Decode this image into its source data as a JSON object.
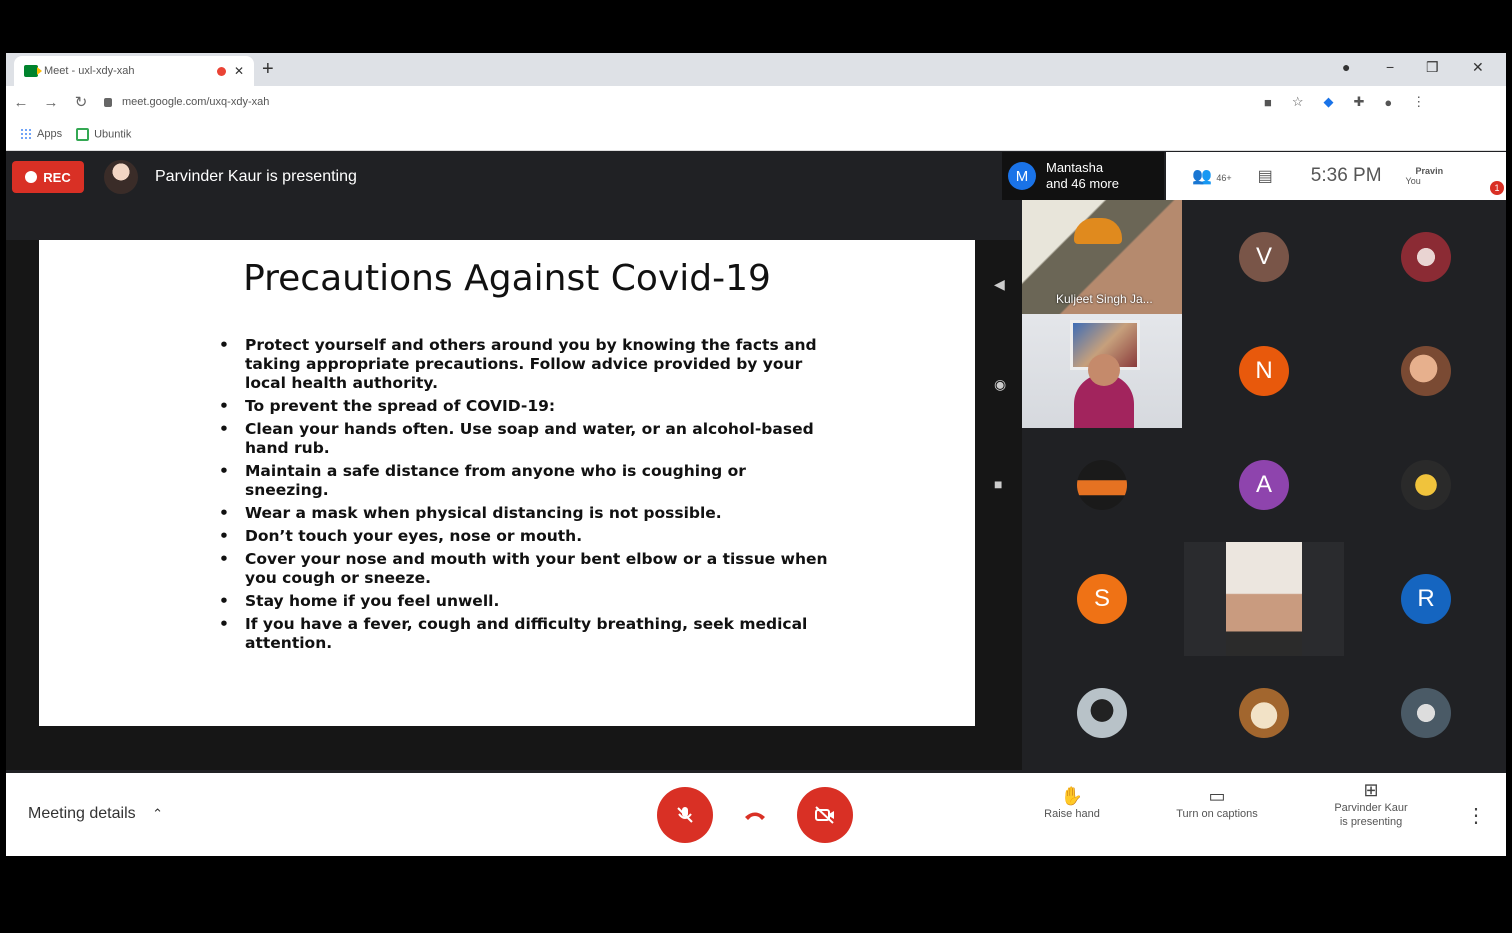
{
  "browser": {
    "tab_title": "Meet - uxl-xdy-xah",
    "new_tab_icon": "+",
    "window_controls": [
      "−",
      "❒",
      "✕"
    ],
    "url": "meet.google.com/uxq-xdy-xah",
    "bookmarks": [
      "Apps",
      "Ubuntik"
    ]
  },
  "header": {
    "rec_label": "REC",
    "presenting_text": "Parvinder Kaur is presenting",
    "participants_line1": "Mantasha",
    "participants_line2": "and 46 more",
    "participants_avatar": "M",
    "people_count": "46+",
    "clock": "5:36 PM",
    "you_label": "You",
    "you_name": "Pravin",
    "notif_count": "1"
  },
  "slide": {
    "title": "Precautions Against Covid-19",
    "bullets": [
      "Protect yourself and others around you by knowing the facts and taking appropriate precautions. Follow advice provided by your local health authority.",
      "To prevent the spread of COVID-19:",
      "Clean your hands often. Use soap and water, or an alcohol-based hand rub.",
      "Maintain a safe distance from anyone who is coughing or sneezing.",
      "Wear a mask when physical distancing is not possible.",
      "Don’t touch your eyes, nose or mouth.",
      "Cover your nose and mouth with your bent elbow or a tissue when you cough or sneeze.",
      "Stay home if you feel unwell.",
      "If you have a fever, cough and difficulty breathing, seek medical attention."
    ]
  },
  "tiles": {
    "video1_name": "Kuljeet Singh Ja...",
    "letters": {
      "v": "V",
      "n": "N",
      "a": "A",
      "s": "S",
      "r": "R"
    }
  },
  "colors": {
    "rec": "#d93025",
    "v": "#795548",
    "n": "#e8590c",
    "a": "#8e44ad",
    "s": "#ef7215",
    "r": "#1565c0",
    "m": "#1a73e8"
  },
  "bottom": {
    "meeting_details": "Meeting details",
    "raise_hand": "Raise hand",
    "captions": "Turn on captions",
    "presenting_line1": "Parvinder Kaur",
    "presenting_line2": "is presenting"
  }
}
